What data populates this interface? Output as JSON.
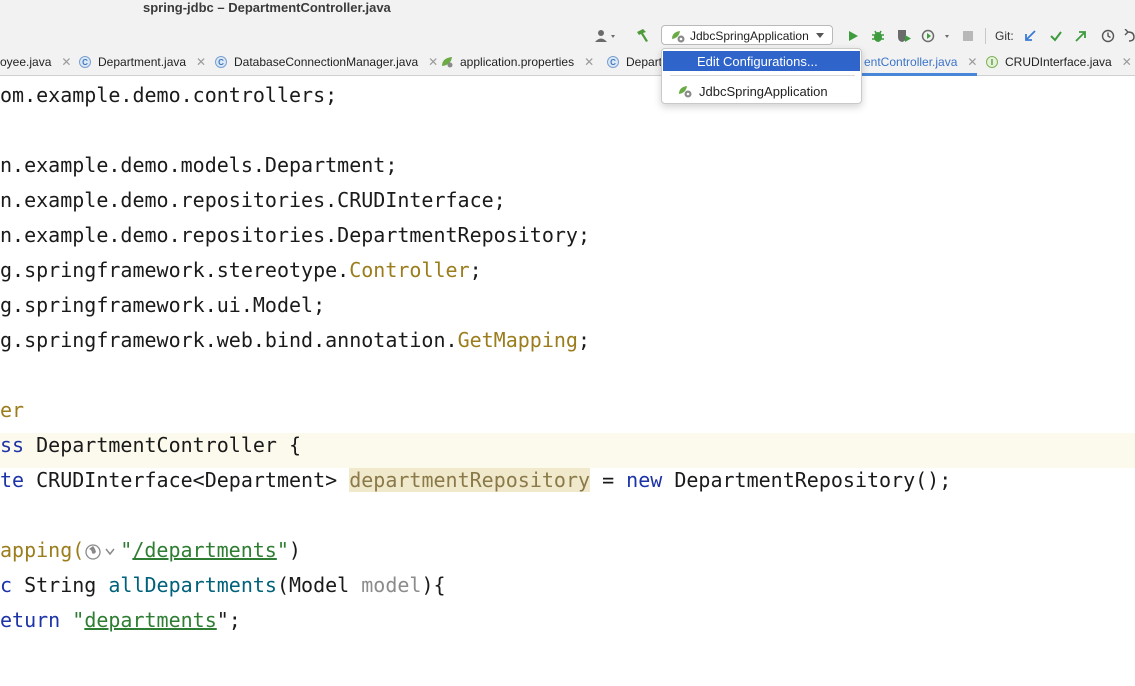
{
  "window": {
    "title": "spring-jdbc – DepartmentController.java"
  },
  "toolbar": {
    "run_config": "JdbcSpringApplication",
    "git_label": "Git:"
  },
  "tabs": [
    {
      "label": "oyee.java",
      "icon": "class-c-icon"
    },
    {
      "label": "Department.java",
      "icon": "class-c-icon"
    },
    {
      "label": "DatabaseConnectionManager.java",
      "icon": "class-c-icon"
    },
    {
      "label": "application.properties",
      "icon": "spring-leaf-icon"
    },
    {
      "label": "Departr",
      "icon": "class-c-icon"
    },
    {
      "label": "entController.java",
      "icon": "class-c-icon",
      "active": true
    },
    {
      "label": "CRUDInterface.java",
      "icon": "interface-i-icon"
    }
  ],
  "dropdown": {
    "items": [
      {
        "label": "Edit Configurations...",
        "selected": true
      },
      {
        "label": "JdbcSpringApplication",
        "selected": false
      }
    ]
  },
  "code": {
    "l1_a": "om.example.demo.controllers;",
    "l2_a": "n.example.demo.models.Department;",
    "l3_a": "n.example.demo.repositories.CRUDInterface;",
    "l4_a": "n.example.demo.repositories.DepartmentRepository;",
    "l5_a": "g.springframework.stereotype.",
    "l5_b": "Controller",
    "l5_c": ";",
    "l6_a": "g.springframework.ui.Model;",
    "l7_a": "g.springframework.web.bind.annotation.",
    "l7_b": "GetMapping",
    "l7_c": ";",
    "l8_a": "er",
    "l9_a": "ss",
    "l9_b": " DepartmentController {",
    "l10_a": "te",
    "l10_b": " CRUDInterface<Department> ",
    "l10_c": "departmentRepository",
    "l10_d": " = ",
    "l10_e": "new",
    "l10_f": " DepartmentRepository();",
    "l11_a": "apping(",
    "l11_b": "\"",
    "l11_c": "/departments",
    "l11_d": "\"",
    "l11_e": ")",
    "l12_a": "c",
    "l12_b": " String ",
    "l12_c": "allDepartments",
    "l12_d": "(Model ",
    "l12_e": "model",
    "l12_f": "){",
    "l13_a": "eturn",
    "l13_b": " \"",
    "l13_c": "departments",
    "l13_d": "\";"
  },
  "colors": {
    "keyword": "#1d33a8",
    "annotation": "#9b7d1d",
    "string": "#2e7d32",
    "selection": "#2f65ca"
  }
}
